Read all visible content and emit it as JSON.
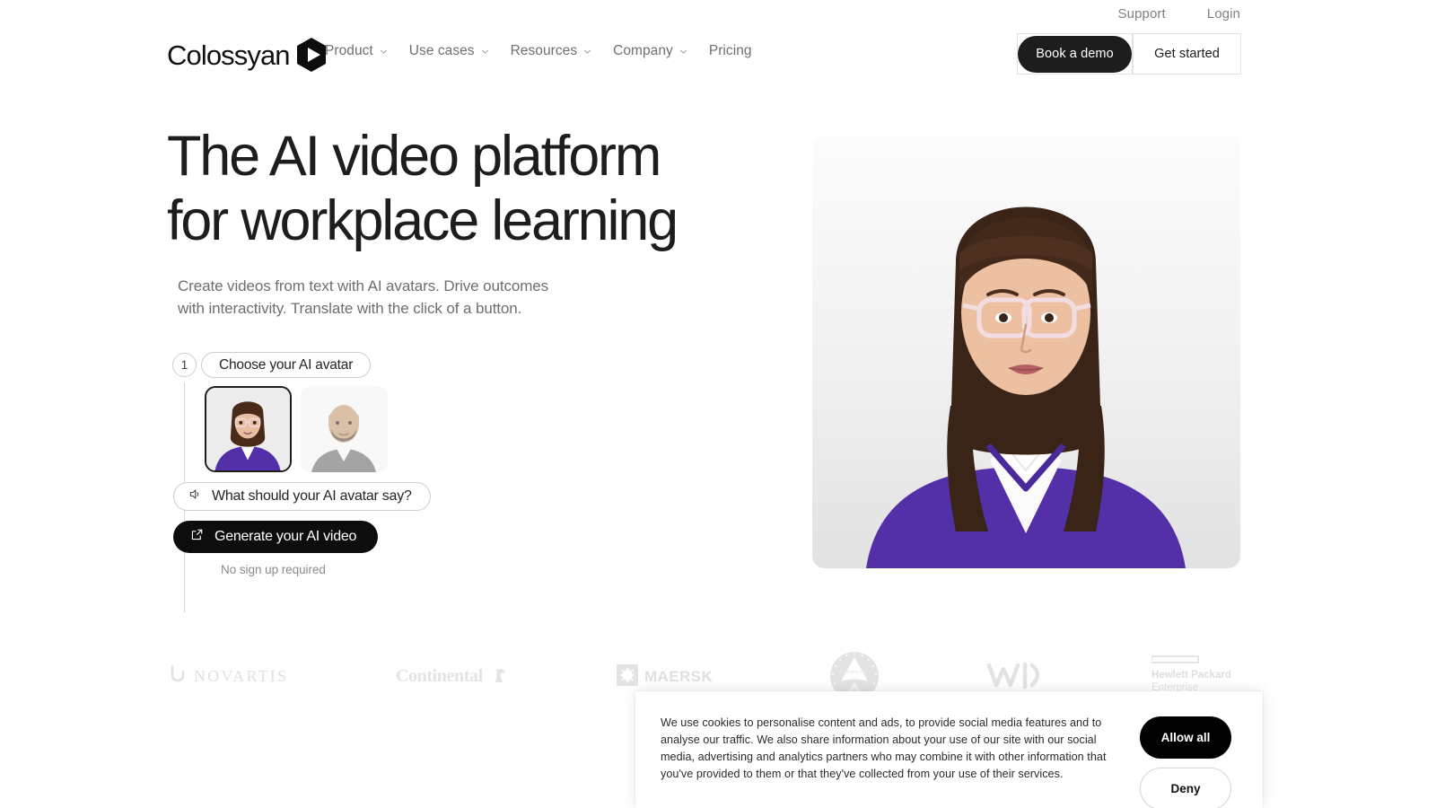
{
  "utility": {
    "links": [
      {
        "label": "Support"
      },
      {
        "label": "Login"
      }
    ]
  },
  "header": {
    "brand": "Colossyan",
    "logo_icon": "colossyan-hexagon-play-logo",
    "nav": [
      {
        "label": "Product",
        "has_dropdown": true
      },
      {
        "label": "Use cases",
        "has_dropdown": true
      },
      {
        "label": "Resources",
        "has_dropdown": true
      },
      {
        "label": "Company",
        "has_dropdown": true
      },
      {
        "label": "Pricing",
        "has_dropdown": false
      }
    ],
    "book_demo_label": "Book a demo",
    "get_started_label": "Get started"
  },
  "hero": {
    "headline_line1": "The AI video platform",
    "headline_line2": "for workplace learning",
    "subhead": "Create videos from text with AI avatars. Drive outcomes with interactivity. Translate with the click of a button.",
    "image_alt": "AI avatar woman with glasses in purple sweater"
  },
  "widget": {
    "step_number": "1",
    "step_label": "Choose your AI avatar",
    "avatars": [
      {
        "name": "avatar-woman-glasses-purple",
        "selected": true
      },
      {
        "name": "avatar-man-beard-gray",
        "selected": false
      }
    ],
    "say_prompt": "What should your AI avatar say?",
    "say_icon": "speaker-icon",
    "generate_label": "Generate your AI video",
    "generate_icon": "external-link-icon",
    "no_signup": "No sign up required"
  },
  "logos": [
    {
      "name": "novartis",
      "label": "NOVARTIS"
    },
    {
      "name": "continental",
      "label": "Continental"
    },
    {
      "name": "maersk",
      "label": "MAERSK"
    },
    {
      "name": "paramount",
      "label": "Paramount"
    },
    {
      "name": "wsp",
      "label": "WSP"
    },
    {
      "name": "hewlett-packard-enterprise",
      "label": "Hewlett Packard Enterprise"
    }
  ],
  "cookie": {
    "message": "We use cookies to personalise content and ads, to provide social media features and to analyse our traffic. We also share information about your use of our site with our social media, advertising and analytics partners who may combine it with other information that you've provided to them or that they've collected from your use of their services.",
    "allow_label": "Allow all",
    "deny_label": "Deny"
  },
  "colors": {
    "accent_dark": "#1d1d1d",
    "avatar_sweater_purple": "#5330a8",
    "muted_text": "#6f6f6f",
    "border": "#cfcfcf"
  }
}
